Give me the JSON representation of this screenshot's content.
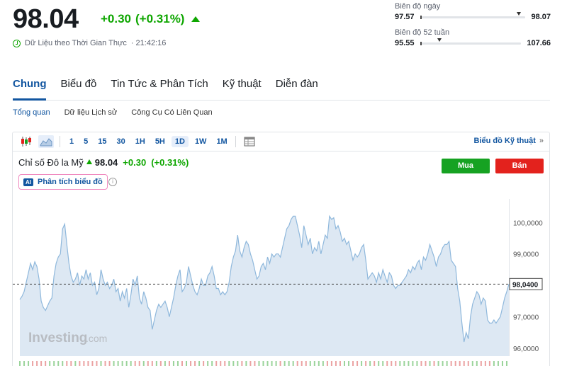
{
  "quote": {
    "price": "98.04",
    "change": "+0.30",
    "change_pct": "(+0.31%)",
    "realtime_label": "Dữ Liệu theo Thời Gian Thực",
    "time": "· 21:42:16"
  },
  "ranges": {
    "day": {
      "label": "Biên độ ngày",
      "low": "97.57",
      "high": "98.07",
      "position": 0.94
    },
    "week52": {
      "label": "Biên độ 52 tuần",
      "low": "95.55",
      "high": "107.66",
      "position": 0.17
    }
  },
  "tabs": [
    {
      "label": "Chung",
      "active": true
    },
    {
      "label": "Biểu đồ",
      "active": false
    },
    {
      "label": "Tin Tức & Phân Tích",
      "active": false
    },
    {
      "label": "Kỹ thuật",
      "active": false
    },
    {
      "label": "Diễn đàn",
      "active": false
    }
  ],
  "subtabs": [
    {
      "label": "Tổng quan",
      "active": true
    },
    {
      "label": "Dữ liệu Lịch sử",
      "active": false
    },
    {
      "label": "Công Cụ Có Liên Quan",
      "active": false
    }
  ],
  "toolbar": {
    "intervals": [
      "1",
      "5",
      "15",
      "30",
      "1H",
      "5H",
      "1D",
      "1W",
      "1M"
    ],
    "active_interval": "1D",
    "tech_chart_link": "Biểu đồ Kỹ thuật",
    "arrow": "»"
  },
  "chart_header": {
    "name": "Chỉ số Đô la Mỹ",
    "price": "98.04",
    "change": "+0.30",
    "change_pct": "(+0.31%)",
    "buy_label": "Mua",
    "sell_label": "Bán",
    "ai_badge": "AI",
    "ai_label": "Phân tích biểu đồ",
    "info_glyph": "i"
  },
  "colors": {
    "accent": "#1256a0",
    "up": "#0ea600",
    "buy": "#16a222",
    "sell": "#e3221d",
    "line": "#8fb8dc",
    "area": "#dde8f3"
  },
  "chart_data": {
    "type": "area",
    "watermark": "Investing",
    "watermark_suffix": ".com",
    "current_value_label": "98,0400",
    "current_value": 98.04,
    "ylim": [
      95.75,
      100.75
    ],
    "y_ticks": [
      {
        "value": 100.0,
        "label": "100,0000"
      },
      {
        "value": 99.0,
        "label": "99,0000"
      },
      {
        "value": 98.0,
        "label": "98,0000"
      },
      {
        "value": 97.0,
        "label": "97,0000"
      },
      {
        "value": 96.0,
        "label": "96,0000"
      }
    ],
    "values": [
      97.55,
      97.65,
      97.8,
      98.1,
      98.4,
      98.7,
      98.5,
      98.75,
      98.6,
      98.2,
      97.5,
      97.3,
      97.2,
      97.35,
      97.5,
      97.6,
      98.3,
      98.7,
      98.9,
      99.0,
      99.8,
      99.95,
      99.3,
      98.7,
      98.3,
      98.1,
      98.2,
      98.4,
      98.0,
      98.3,
      98.2,
      98.5,
      98.2,
      98.4,
      98.0,
      98.1,
      97.7,
      97.9,
      98.5,
      98.2,
      98.0,
      98.1,
      97.9,
      98.0,
      98.2,
      97.8,
      97.9,
      97.5,
      97.8,
      97.6,
      97.9,
      97.3,
      97.7,
      98.2,
      98.0,
      98.3,
      97.6,
      97.4,
      97.8,
      97.6,
      97.3,
      97.2,
      96.6,
      96.9,
      97.2,
      97.4,
      97.3,
      97.4,
      97.5,
      97.3,
      97.0,
      97.3,
      97.6,
      98.0,
      98.3,
      98.5,
      97.8,
      97.9,
      98.1,
      98.6,
      98.3,
      98.0,
      97.8,
      97.7,
      97.9,
      98.2,
      98.0,
      98.0,
      98.3,
      98.4,
      98.6,
      98.3,
      97.9,
      97.9,
      97.7,
      97.8,
      97.7,
      97.8,
      98.1,
      98.6,
      98.9,
      99.1,
      99.6,
      99.1,
      98.9,
      99.2,
      99.4,
      99.3,
      99.0,
      98.8,
      98.5,
      98.2,
      98.3,
      98.6,
      98.7,
      98.5,
      98.9,
      98.7,
      99.0,
      98.9,
      99.0,
      99.0,
      98.9,
      99.2,
      99.5,
      99.8,
      99.9,
      100.1,
      100.2,
      100.2,
      99.9,
      99.6,
      99.2,
      99.9,
      99.6,
      99.3,
      99.5,
      99.0,
      99.2,
      99.1,
      99.4,
      99.0,
      99.3,
      99.6,
      99.5,
      100.2,
      100.1,
      100.15,
      99.8,
      99.9,
      99.7,
      99.4,
      99.5,
      99.3,
      99.4,
      99.1,
      98.8,
      99.0,
      98.9,
      99.0,
      99.2,
      99.3,
      98.8,
      98.2,
      98.3,
      98.4,
      98.3,
      98.1,
      98.4,
      98.2,
      98.5,
      98.3,
      98.1,
      98.4,
      98.3,
      98.0,
      97.9,
      98.0,
      98.0,
      98.1,
      98.2,
      98.3,
      98.5,
      98.4,
      98.6,
      98.5,
      98.7,
      98.8,
      98.5,
      98.9,
      98.8,
      99.0,
      99.3,
      99.1,
      98.9,
      98.6,
      98.9,
      99.0,
      99.2,
      99.3,
      99.3,
      99.4,
      98.8,
      98.7,
      98.6,
      97.9,
      97.5,
      96.8,
      96.2,
      96.5,
      96.3,
      97.0,
      97.4,
      97.6,
      97.8,
      97.7,
      97.4,
      97.6,
      97.5,
      96.9,
      96.8,
      96.8,
      96.9,
      96.8,
      96.9,
      97.0,
      97.3,
      97.6,
      97.8,
      98.04
    ]
  }
}
